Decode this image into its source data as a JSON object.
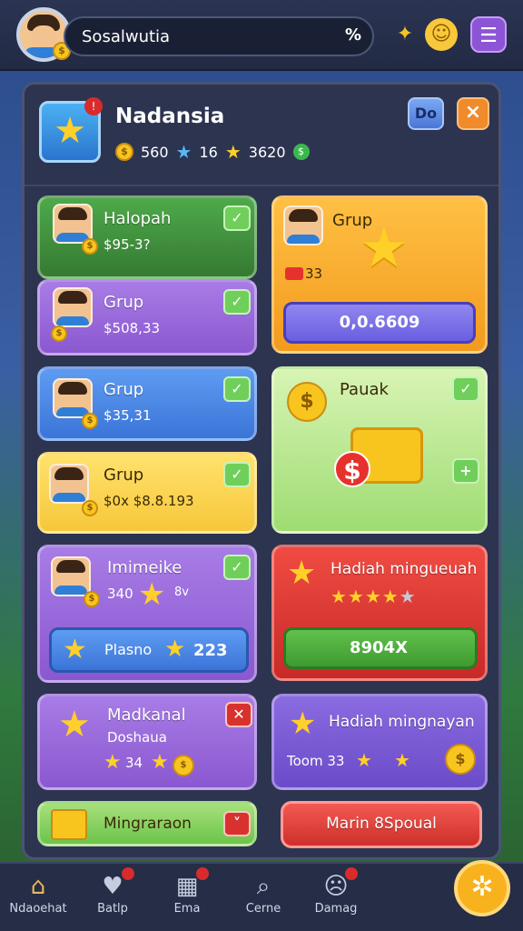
{
  "topbar": {
    "title": "Sosalwutia",
    "search_icon": "%",
    "avatar_coin": "$"
  },
  "header": {
    "title": "Nadansia",
    "coins": "560",
    "blue_stars": "16",
    "stars": "3620",
    "do_label": "Do",
    "close_label": "×"
  },
  "cards": {
    "c1": {
      "title": "Halopah",
      "value": "$95-3?"
    },
    "c2": {
      "title": "Grup",
      "value": "$508,33"
    },
    "c3": {
      "title": "Grup",
      "value": "$35,31"
    },
    "c4": {
      "title": "Grup",
      "value": "$0x $8.8.193"
    },
    "c5": {
      "title": "Imimeike",
      "count": "340",
      "small": "8v",
      "pill_label": "Plasno",
      "pill_value": "223"
    },
    "c6": {
      "title": "Madkanal",
      "sub": "Doshaua",
      "value": "34"
    },
    "c7": {
      "title": "Mingraraon"
    },
    "r1": {
      "title": "Grup",
      "value": "33",
      "pill": "0,0.6609"
    },
    "r2": {
      "title": "Pauak"
    },
    "r3": {
      "title": "Hadiah mingueuah",
      "pill": "8904X"
    },
    "r4": {
      "title": "Hadiah mingnayan",
      "sub": "Toom 33"
    },
    "r5": {
      "title": "Marin 8Spoual"
    }
  },
  "nav": [
    {
      "label": "Ndaoehat",
      "icon": "home-icon"
    },
    {
      "label": "Batlp",
      "icon": "heart-icon"
    },
    {
      "label": "Ema",
      "icon": "grid-icon"
    },
    {
      "label": "Cerne",
      "icon": "search-icon"
    },
    {
      "label": "Damag",
      "icon": "sad-face-icon"
    }
  ],
  "colors": {
    "green": "#4ea94a",
    "purple": "#a87ce6",
    "blue": "#5e9cf2",
    "yellow": "#f7c73a",
    "orange": "#f29a1e",
    "red": "#c82a28",
    "fab": "#f7b21e"
  }
}
